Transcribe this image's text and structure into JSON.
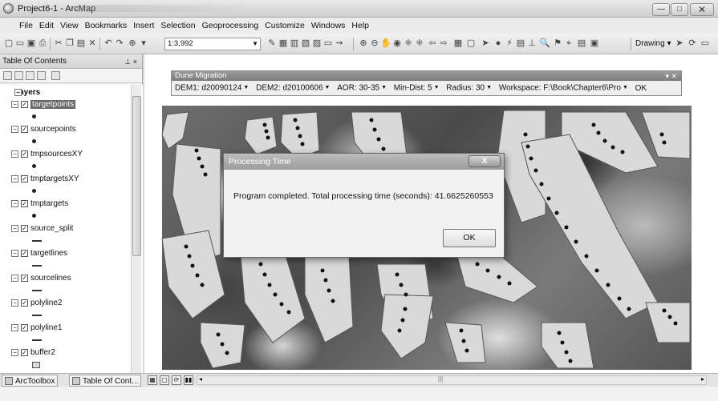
{
  "window": {
    "title": "Project6-1 - ArcMap"
  },
  "menu": [
    "File",
    "Edit",
    "View",
    "Bookmarks",
    "Insert",
    "Selection",
    "Geoprocessing",
    "Customize",
    "Windows",
    "Help"
  ],
  "toolbar": {
    "scale": "1:3,992",
    "drawing_label": "Drawing"
  },
  "toc": {
    "title": "Table Of Contents",
    "root": "Layers",
    "layers": [
      {
        "name": "targetpoints",
        "symbol": "point",
        "selected": true
      },
      {
        "name": "sourcepoints",
        "symbol": "point"
      },
      {
        "name": "tmpsourcesXY",
        "symbol": "point"
      },
      {
        "name": "tmptargetsXY",
        "symbol": "point"
      },
      {
        "name": "tmptargets",
        "symbol": "point"
      },
      {
        "name": "source_split",
        "symbol": "line"
      },
      {
        "name": "targetlines",
        "symbol": "line"
      },
      {
        "name": "sourcelines",
        "symbol": "line"
      },
      {
        "name": "polyline2",
        "symbol": "line"
      },
      {
        "name": "polyline1",
        "symbol": "line"
      },
      {
        "name": "buffer2",
        "symbol": "polygon"
      }
    ]
  },
  "dune_toolbar": {
    "title": "Dune Migration",
    "dem1_label": "DEM1:",
    "dem1_value": "d20090124",
    "dem2_label": "DEM2:",
    "dem2_value": "d20100606",
    "aor_label": "AOR:",
    "aor_value": "30-35",
    "mindist_label": "Min-Dist:",
    "mindist_value": "5",
    "radius_label": "Radius:",
    "radius_value": "30",
    "workspace_label": "Workspace:",
    "workspace_value": "F:\\Book\\Chapter6\\Pro",
    "ok_label": "OK"
  },
  "dialog": {
    "title": "Processing Time",
    "message": "Program completed. Total processing time (seconds): 41.6625260553",
    "ok_label": "OK",
    "close_glyph": "X"
  },
  "bottom": {
    "tab_arctoolbox": "ArcToolbox",
    "tab_toc": "Table Of Cont..."
  }
}
